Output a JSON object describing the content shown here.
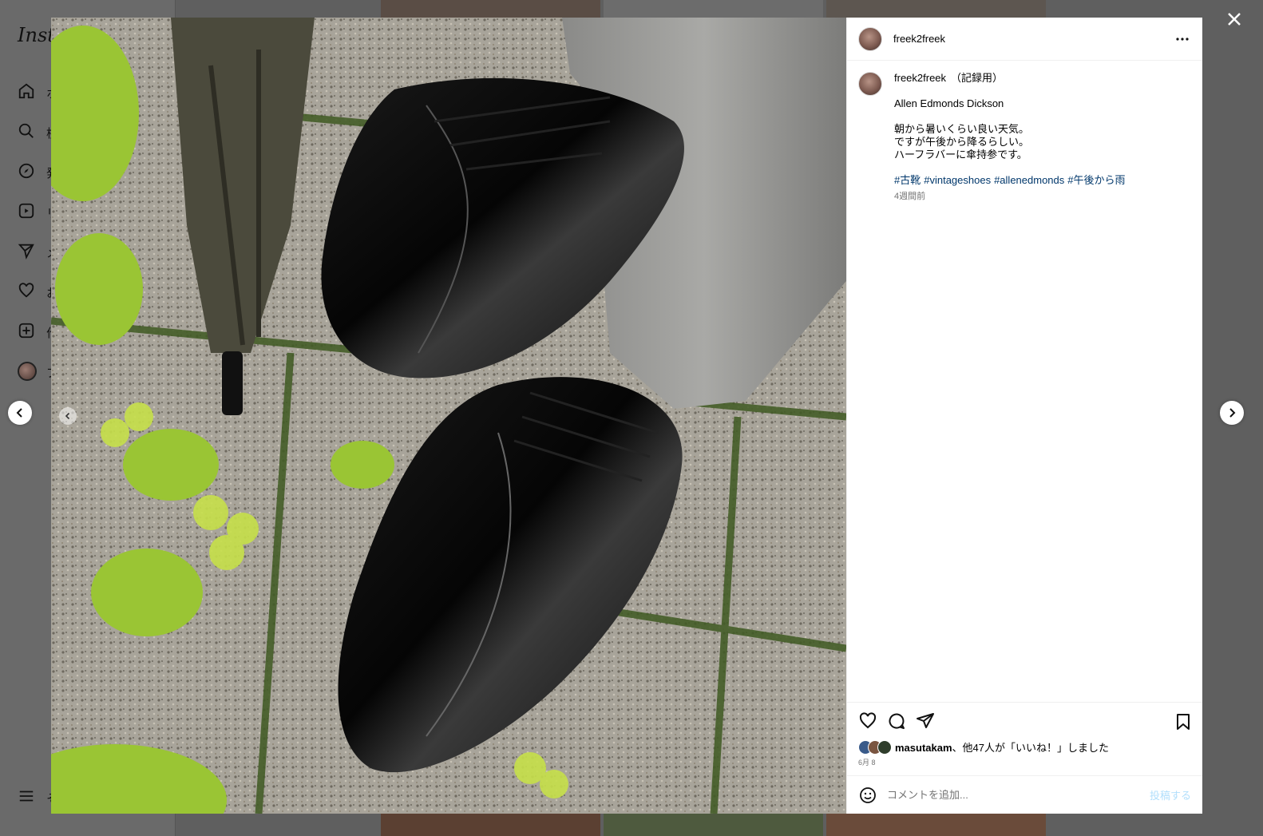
{
  "background": {
    "logo": "Insta",
    "nav": [
      {
        "label": "ホ",
        "icon": "home-icon"
      },
      {
        "label": "検",
        "icon": "search-icon"
      },
      {
        "label": "発",
        "icon": "explore-icon"
      },
      {
        "label": "リ",
        "icon": "reels-icon"
      },
      {
        "label": "メ",
        "icon": "messages-icon"
      },
      {
        "label": "お",
        "icon": "heart-icon"
      },
      {
        "label": "作",
        "icon": "create-icon"
      },
      {
        "label": "プ",
        "icon": "profile-avatar"
      }
    ],
    "more_label": "そ"
  },
  "post": {
    "username": "freek2freek",
    "caption": {
      "title": "（記録用）",
      "lines": [
        "Allen Edmonds Dickson"
      ],
      "body_lines": [
        "朝から暑いくらい良い天気。",
        "ですが午後から降るらしい。",
        "ハーフラバーに傘持参です。"
      ],
      "hashtags": [
        "#古靴",
        "#vintageshoes",
        "#allenedmonds",
        "#午後から雨"
      ],
      "time": "4週間前"
    },
    "likes": {
      "user": "masutakam",
      "rest": "、他47人が「いいね！」しました"
    },
    "date": "6月 8",
    "comment": {
      "placeholder": "コメントを追加...",
      "post_label": "投稿する"
    }
  },
  "colors": {
    "accent": "#0095f6",
    "hashtag": "#00376b",
    "muted": "#737373"
  }
}
